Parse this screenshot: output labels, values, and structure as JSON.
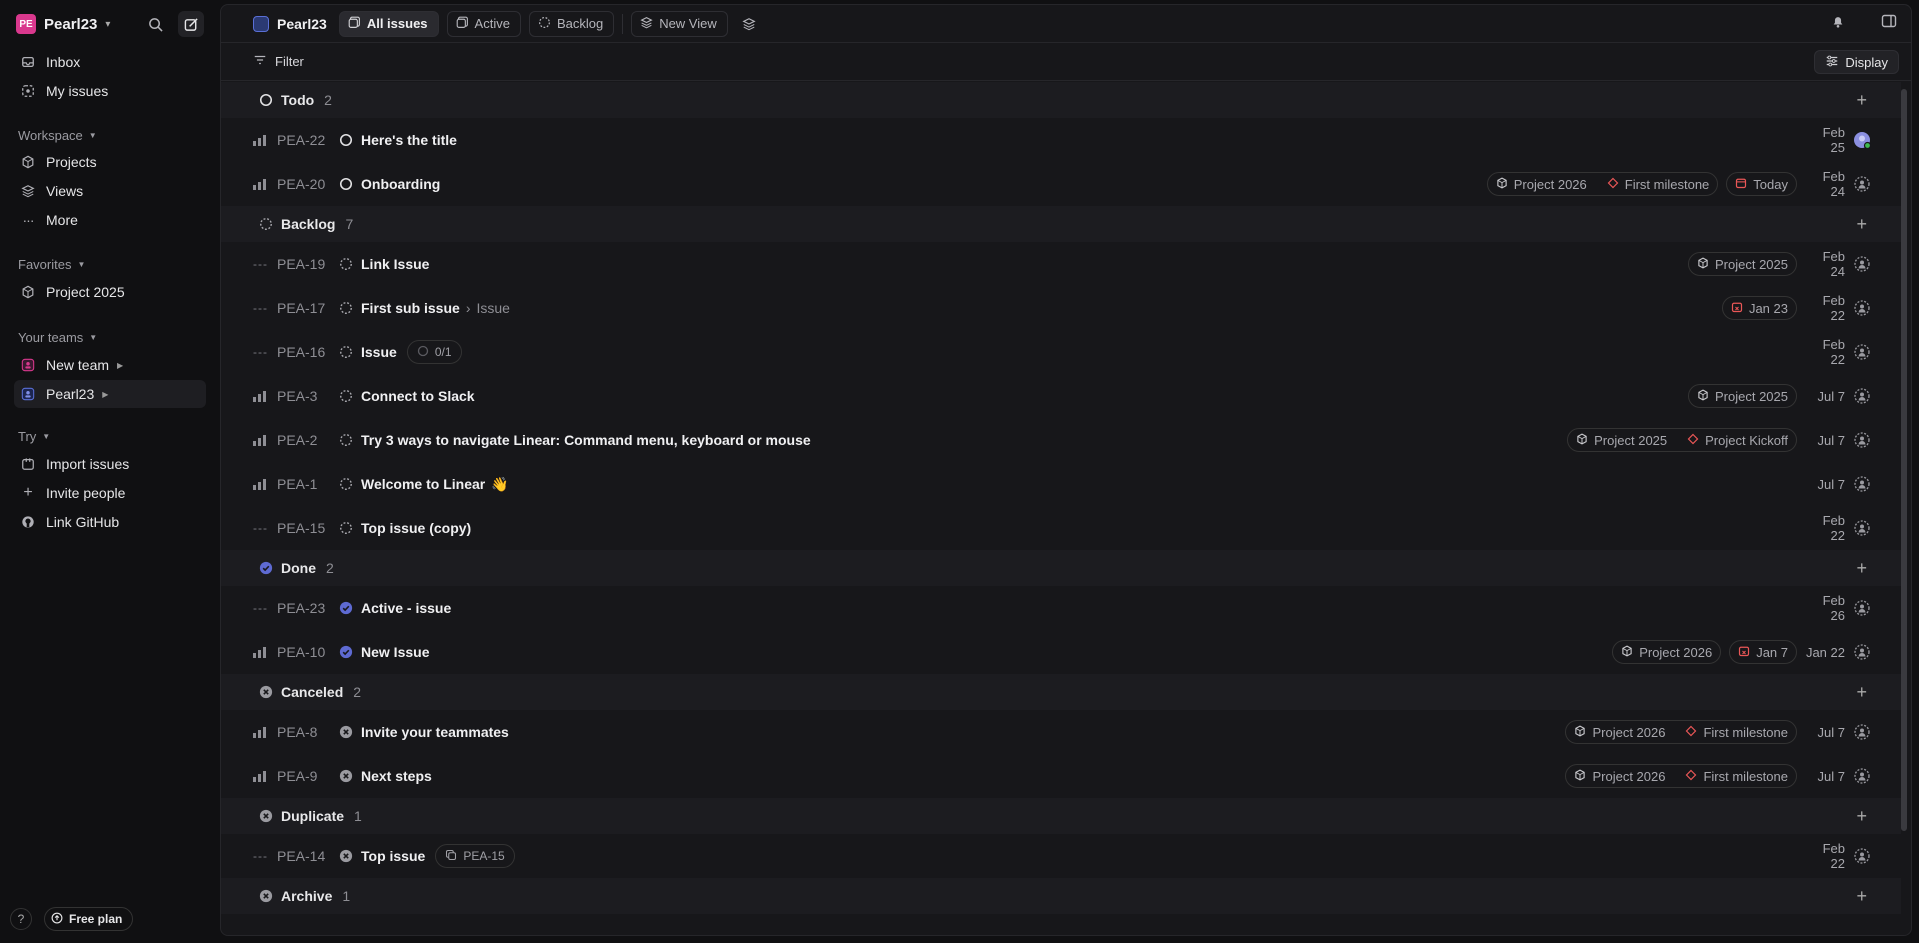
{
  "workspace": {
    "initials": "PE",
    "name": "Pearl23"
  },
  "sidebar": {
    "top": [
      {
        "label": "Inbox",
        "icon": "inbox-icon"
      },
      {
        "label": "My issues",
        "icon": "my-issues-icon"
      }
    ],
    "workspace_label": "Workspace",
    "workspace_items": [
      {
        "label": "Projects",
        "icon": "cube-icon"
      },
      {
        "label": "Views",
        "icon": "layers-icon"
      },
      {
        "label": "More",
        "icon": "dots-icon"
      }
    ],
    "favorites_label": "Favorites",
    "favorites": [
      {
        "label": "Project 2025",
        "icon": "cube-icon"
      }
    ],
    "teams_label": "Your teams",
    "teams": [
      {
        "label": "New team"
      },
      {
        "label": "Pearl23"
      }
    ],
    "try_label": "Try",
    "try_items": [
      {
        "label": "Import issues"
      },
      {
        "label": "Invite people"
      },
      {
        "label": "Link GitHub"
      }
    ],
    "help": "?",
    "free_plan": "Free plan"
  },
  "topbar": {
    "team": "Pearl23",
    "tabs": [
      "All issues",
      "Active",
      "Backlog",
      "New View"
    ]
  },
  "filterbar": {
    "filter": "Filter",
    "display": "Display"
  },
  "groups": [
    {
      "name": "Todo",
      "count": "2"
    },
    {
      "name": "Backlog",
      "count": "7"
    },
    {
      "name": "Done",
      "count": "2"
    },
    {
      "name": "Canceled",
      "count": "2"
    },
    {
      "name": "Duplicate",
      "count": "1"
    },
    {
      "name": "Archive",
      "count": "1"
    }
  ],
  "issues": [
    {
      "id": "PEA-22",
      "title": "Here's the title",
      "date": "Feb 25"
    },
    {
      "id": "PEA-20",
      "title": "Onboarding",
      "date": "Feb 24",
      "project": "Project 2026",
      "milestone": "First milestone",
      "due": "Today"
    },
    {
      "id": "PEA-19",
      "title": "Link Issue",
      "date": "Feb 24",
      "project": "Project 2025"
    },
    {
      "id": "PEA-17",
      "title": "First sub issue",
      "parent": "Issue",
      "date": "Feb 22",
      "due": "Jan 23"
    },
    {
      "id": "PEA-16",
      "title": "Issue",
      "sub": "0/1",
      "date": "Feb 22"
    },
    {
      "id": "PEA-3",
      "title": "Connect to Slack",
      "date": "Jul 7",
      "project": "Project 2025"
    },
    {
      "id": "PEA-2",
      "title": "Try 3 ways to navigate Linear: Command menu, keyboard or mouse",
      "date": "Jul 7",
      "project": "Project 2025",
      "milestone": "Project Kickoff"
    },
    {
      "id": "PEA-1",
      "title": "Welcome to Linear",
      "emoji": "👋",
      "date": "Jul 7"
    },
    {
      "id": "PEA-15",
      "title": "Top issue (copy)",
      "date": "Feb 22"
    },
    {
      "id": "PEA-23",
      "title": "Active - issue",
      "date": "Feb 26"
    },
    {
      "id": "PEA-10",
      "title": "New Issue",
      "date": "Jan 22",
      "project": "Project 2026",
      "due": "Jan 7"
    },
    {
      "id": "PEA-8",
      "title": "Invite your teammates",
      "date": "Jul 7",
      "project": "Project 2026",
      "milestone": "First milestone"
    },
    {
      "id": "PEA-9",
      "title": "Next steps",
      "date": "Jul 7",
      "project": "Project 2026",
      "milestone": "First milestone"
    },
    {
      "id": "PEA-14",
      "title": "Top issue",
      "dup": "PEA-15",
      "date": "Feb 22"
    }
  ],
  "colors": {
    "accent": "#5e6ad2",
    "danger": "#eb5757",
    "avatar": "#d9388d"
  }
}
